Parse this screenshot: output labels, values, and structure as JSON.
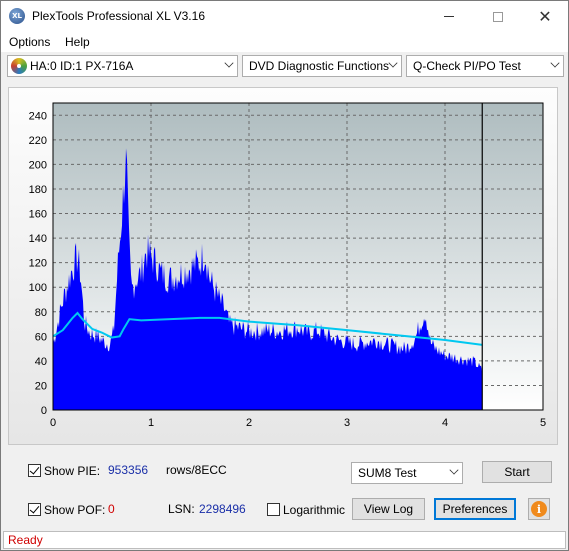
{
  "window": {
    "title": "PlexTools Professional XL V3.16",
    "icon_text": "XL",
    "minimize_icon": "minimize-icon",
    "maximize_icon": "maximize-icon",
    "close_glyph": "✕"
  },
  "menu": {
    "options": "Options",
    "help": "Help"
  },
  "toolbar": {
    "drive": "HA:0 ID:1  PX-716A",
    "function": "DVD Diagnostic Functions",
    "test": "Q-Check PI/PO Test"
  },
  "chart_data": {
    "type": "area",
    "x_range": [
      0,
      5
    ],
    "y_range": [
      0,
      250
    ],
    "x_ticks": [
      "0",
      "1",
      "2",
      "3",
      "4",
      "5"
    ],
    "y_ticks": [
      "0",
      "20",
      "40",
      "60",
      "80",
      "100",
      "120",
      "140",
      "160",
      "180",
      "200",
      "220",
      "240"
    ],
    "grid": true,
    "end_marker_x": 4.38,
    "colors": {
      "pie_fill": "#0000ff",
      "avg_line": "#00c8f0",
      "plot_bg_top": "#aebcbf",
      "plot_bg_bottom": "#ffffff"
    },
    "pie_envelope": [
      [
        0.0,
        60
      ],
      [
        0.05,
        80
      ],
      [
        0.1,
        100
      ],
      [
        0.15,
        115
      ],
      [
        0.2,
        130
      ],
      [
        0.25,
        140
      ],
      [
        0.28,
        125
      ],
      [
        0.32,
        80
      ],
      [
        0.38,
        70
      ],
      [
        0.45,
        68
      ],
      [
        0.52,
        62
      ],
      [
        0.58,
        60
      ],
      [
        0.62,
        72
      ],
      [
        0.66,
        130
      ],
      [
        0.7,
        175
      ],
      [
        0.73,
        215
      ],
      [
        0.75,
        228
      ],
      [
        0.77,
        160
      ],
      [
        0.8,
        110
      ],
      [
        0.85,
        120
      ],
      [
        0.9,
        125
      ],
      [
        0.95,
        145
      ],
      [
        1.0,
        140
      ],
      [
        1.05,
        135
      ],
      [
        1.1,
        125
      ],
      [
        1.2,
        120
      ],
      [
        1.3,
        125
      ],
      [
        1.4,
        130
      ],
      [
        1.5,
        135
      ],
      [
        1.55,
        145
      ],
      [
        1.6,
        120
      ],
      [
        1.65,
        110
      ],
      [
        1.7,
        100
      ],
      [
        1.75,
        92
      ],
      [
        1.8,
        78
      ],
      [
        1.9,
        75
      ],
      [
        2.0,
        72
      ],
      [
        2.1,
        72
      ],
      [
        2.2,
        73
      ],
      [
        2.3,
        72
      ],
      [
        2.4,
        74
      ],
      [
        2.5,
        75
      ],
      [
        2.6,
        70
      ],
      [
        2.7,
        73
      ],
      [
        2.8,
        68
      ],
      [
        2.9,
        64
      ],
      [
        3.0,
        62
      ],
      [
        3.1,
        60
      ],
      [
        3.2,
        62
      ],
      [
        3.3,
        64
      ],
      [
        3.4,
        60
      ],
      [
        3.5,
        58
      ],
      [
        3.6,
        56
      ],
      [
        3.7,
        66
      ],
      [
        3.75,
        80
      ],
      [
        3.8,
        90
      ],
      [
        3.85,
        62
      ],
      [
        3.9,
        56
      ],
      [
        4.0,
        50
      ],
      [
        4.1,
        48
      ],
      [
        4.2,
        46
      ],
      [
        4.3,
        44
      ],
      [
        4.38,
        36
      ]
    ],
    "avg_line": [
      [
        0.0,
        60
      ],
      [
        0.1,
        65
      ],
      [
        0.2,
        75
      ],
      [
        0.25,
        79
      ],
      [
        0.3,
        74
      ],
      [
        0.4,
        66
      ],
      [
        0.5,
        63
      ],
      [
        0.6,
        59
      ],
      [
        0.68,
        60
      ],
      [
        0.72,
        66
      ],
      [
        0.78,
        74
      ],
      [
        0.9,
        73
      ],
      [
        1.2,
        74
      ],
      [
        1.5,
        75
      ],
      [
        1.7,
        75
      ],
      [
        2.0,
        72
      ],
      [
        2.5,
        69
      ],
      [
        3.0,
        65
      ],
      [
        3.5,
        61
      ],
      [
        4.0,
        57
      ],
      [
        4.38,
        53
      ]
    ]
  },
  "bottom": {
    "show_pie_label": "Show PIE:",
    "pie_value": "953356",
    "rows_label": "rows/8ECC",
    "show_pof_label": "Show POF:",
    "pof_value": "0",
    "lsn_label": "LSN:",
    "lsn_value": "2298496",
    "log_label": "Logarithmic",
    "test_select": "SUM8 Test",
    "start": "Start",
    "view_log": "View Log",
    "preferences": "Preferences",
    "info_glyph": "i"
  },
  "status": {
    "text": "Ready"
  }
}
